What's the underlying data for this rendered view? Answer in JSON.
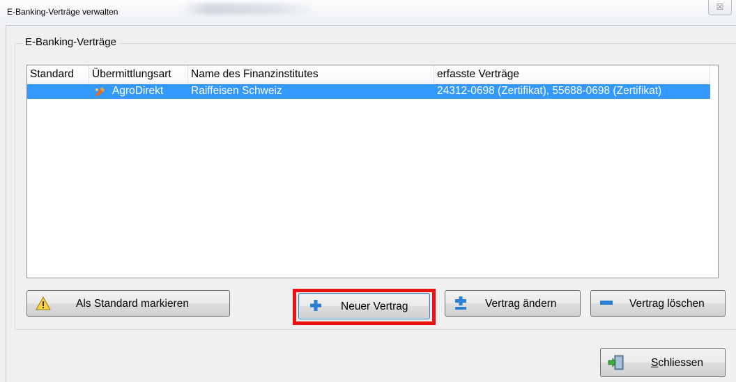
{
  "window": {
    "title": "E-Banking-Verträge verwalten",
    "close_label": "☒"
  },
  "group": {
    "label": "E-Banking-Verträge"
  },
  "table": {
    "columns": [
      "Standard",
      "Übermittlungsart",
      "Name des Finanzinstitutes",
      "erfasste Verträge"
    ],
    "rows": [
      {
        "standard": "",
        "uebermittlungsart": "AgroDirekt",
        "finanzinstitut": "Raiffeisen Schweiz",
        "vertraege": "24312-0698 (Zertifikat), 55688-0698 (Zertifikat)",
        "selected": true
      }
    ]
  },
  "buttons": {
    "standard": "Als Standard markieren",
    "neu": "Neuer Vertrag",
    "aendern": "Vertrag ändern",
    "loeschen": "Vertrag löschen",
    "schliessen_mnemonic": "S",
    "schliessen_rest": "chliessen"
  },
  "colors": {
    "selection": "#3399ff",
    "highlight_box": "#ee1111",
    "icon_blue": "#2b7fd6"
  }
}
